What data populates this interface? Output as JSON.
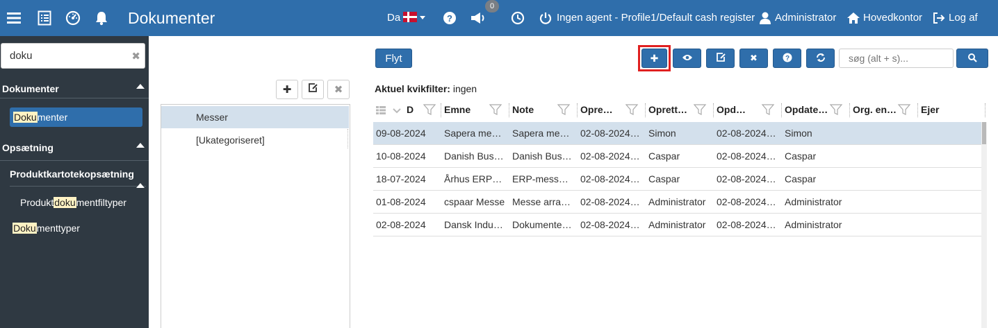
{
  "topbar": {
    "title": "Dokumenter",
    "language": "Da",
    "notification_count": "0",
    "agent_status": "Ingen agent - Profile1/Default cash register",
    "user": "Administrator",
    "location": "Hovedkontor",
    "logout": "Log af"
  },
  "sidebar": {
    "search_value": "doku",
    "sections": {
      "dokumenter": "Dokumenter",
      "opsaetning": "Opsætning",
      "produktkartotek": "Produktkartotekopsætning"
    },
    "items": {
      "dokumenter_hl": "Doku",
      "dokumenter_rest": "menter",
      "produkt_pre": "Produkt",
      "produkt_hl": "doku",
      "produkt_rest": "mentfiltyper",
      "doktyper_hl": "Doku",
      "doktyper_rest": "menttyper"
    }
  },
  "categories": [
    "Messer",
    "[Ukategoriseret]"
  ],
  "toolbar": {
    "move_label": "Flyt",
    "search_placeholder": "søg (alt + s)..."
  },
  "quickfilter": {
    "label": "Aktuel kvikfilter:",
    "value": "ingen"
  },
  "grid": {
    "columns": [
      "D",
      "Emne",
      "Note",
      "Opre…",
      "Oprett…",
      "Opd…",
      "Opdate…",
      "Org. en…",
      "Ejer"
    ],
    "rows": [
      [
        "09-08-2024",
        "Sapera me…",
        "Sapera me…",
        "02-08-2024…",
        "Simon",
        "02-08-2024…",
        "Simon",
        "",
        ""
      ],
      [
        "10-08-2024",
        "Danish Bus…",
        "Danish Bus…",
        "02-08-2024…",
        "Caspar",
        "02-08-2024…",
        "Caspar",
        "",
        ""
      ],
      [
        "18-07-2024",
        "Århus ERP…",
        "ERP-mess…",
        "02-08-2024…",
        "Caspar",
        "02-08-2024…",
        "Caspar",
        "",
        ""
      ],
      [
        "01-08-2024",
        "cspaar Messe",
        "Messe arra…",
        "02-08-2024…",
        "Administrator",
        "02-08-2024…",
        "Administrator",
        "",
        ""
      ],
      [
        "02-08-2024",
        "Dansk Indu…",
        "Dokumente…",
        "02-08-2024…",
        "Administrator",
        "02-08-2024…",
        "Administrator",
        "",
        ""
      ]
    ]
  },
  "colors": {
    "primary": "#2f6eab",
    "sidebar_bg": "#2f3942",
    "highlight": "#fff3c4",
    "selected_row": "#d3e0ec",
    "focus_frame": "#e02020"
  }
}
